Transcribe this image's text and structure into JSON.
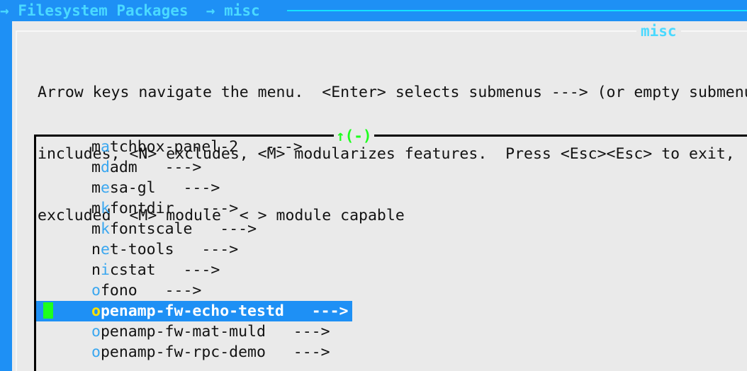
{
  "breadcrumb": {
    "text": "→ Filesystem Packages  → misc",
    "color": "#4ad9ff",
    "bar_color": "#1e90f5",
    "rule_color": "#14e3ff"
  },
  "dialog": {
    "title": "misc",
    "title_color": "#4ad9ff",
    "background": "#eaeaea"
  },
  "help": {
    "line1": "Arrow keys navigate the menu.  <Enter> selects submenus ---> (or empty submenus",
    "line2": "includes, <N> excludes, <M> modularizes features.  Press <Esc><Esc> to exit,",
    "line3": "excluded  <M> module  < > module capable"
  },
  "menu": {
    "scroll_indicator": "↑(-)",
    "scroll_indicator_color": "#1eff1e",
    "submenu_arrow": "--->",
    "mnemonic_color": "#3aa7f0",
    "selected_mnemonic_color": "#ffe000",
    "selected_bg": "#1e90f5",
    "selected_fg": "#ffffff",
    "cursor_block_color": "#1eff1e",
    "items": [
      {
        "pre": "m",
        "mn": "a",
        "post": "tchbox-panel-2",
        "gap": "   ",
        "arrow": "--->",
        "selected": false
      },
      {
        "pre": "m",
        "mn": "d",
        "post": "adm",
        "gap": "   ",
        "arrow": "--->",
        "selected": false
      },
      {
        "pre": "m",
        "mn": "e",
        "post": "sa-gl",
        "gap": "   ",
        "arrow": "--->",
        "selected": false
      },
      {
        "pre": "m",
        "mn": "k",
        "post": "fontdir",
        "gap": "   ",
        "arrow": "--->",
        "selected": false
      },
      {
        "pre": "m",
        "mn": "k",
        "post": "fontscale",
        "gap": "   ",
        "arrow": "--->",
        "selected": false
      },
      {
        "pre": "n",
        "mn": "e",
        "post": "t-tools",
        "gap": "   ",
        "arrow": "--->",
        "selected": false
      },
      {
        "pre": "n",
        "mn": "i",
        "post": "cstat",
        "gap": "   ",
        "arrow": "--->",
        "selected": false
      },
      {
        "pre": "",
        "mn": "o",
        "post": "fono",
        "gap": "   ",
        "arrow": "--->",
        "selected": false
      },
      {
        "pre": "",
        "mn": "o",
        "post": "penamp-fw-echo-testd",
        "gap": "   ",
        "arrow": "--->",
        "selected": true
      },
      {
        "pre": "",
        "mn": "o",
        "post": "penamp-fw-mat-muld",
        "gap": "   ",
        "arrow": "--->",
        "selected": false
      },
      {
        "pre": "",
        "mn": "o",
        "post": "penamp-fw-rpc-demo",
        "gap": "   ",
        "arrow": "--->",
        "selected": false
      }
    ]
  }
}
